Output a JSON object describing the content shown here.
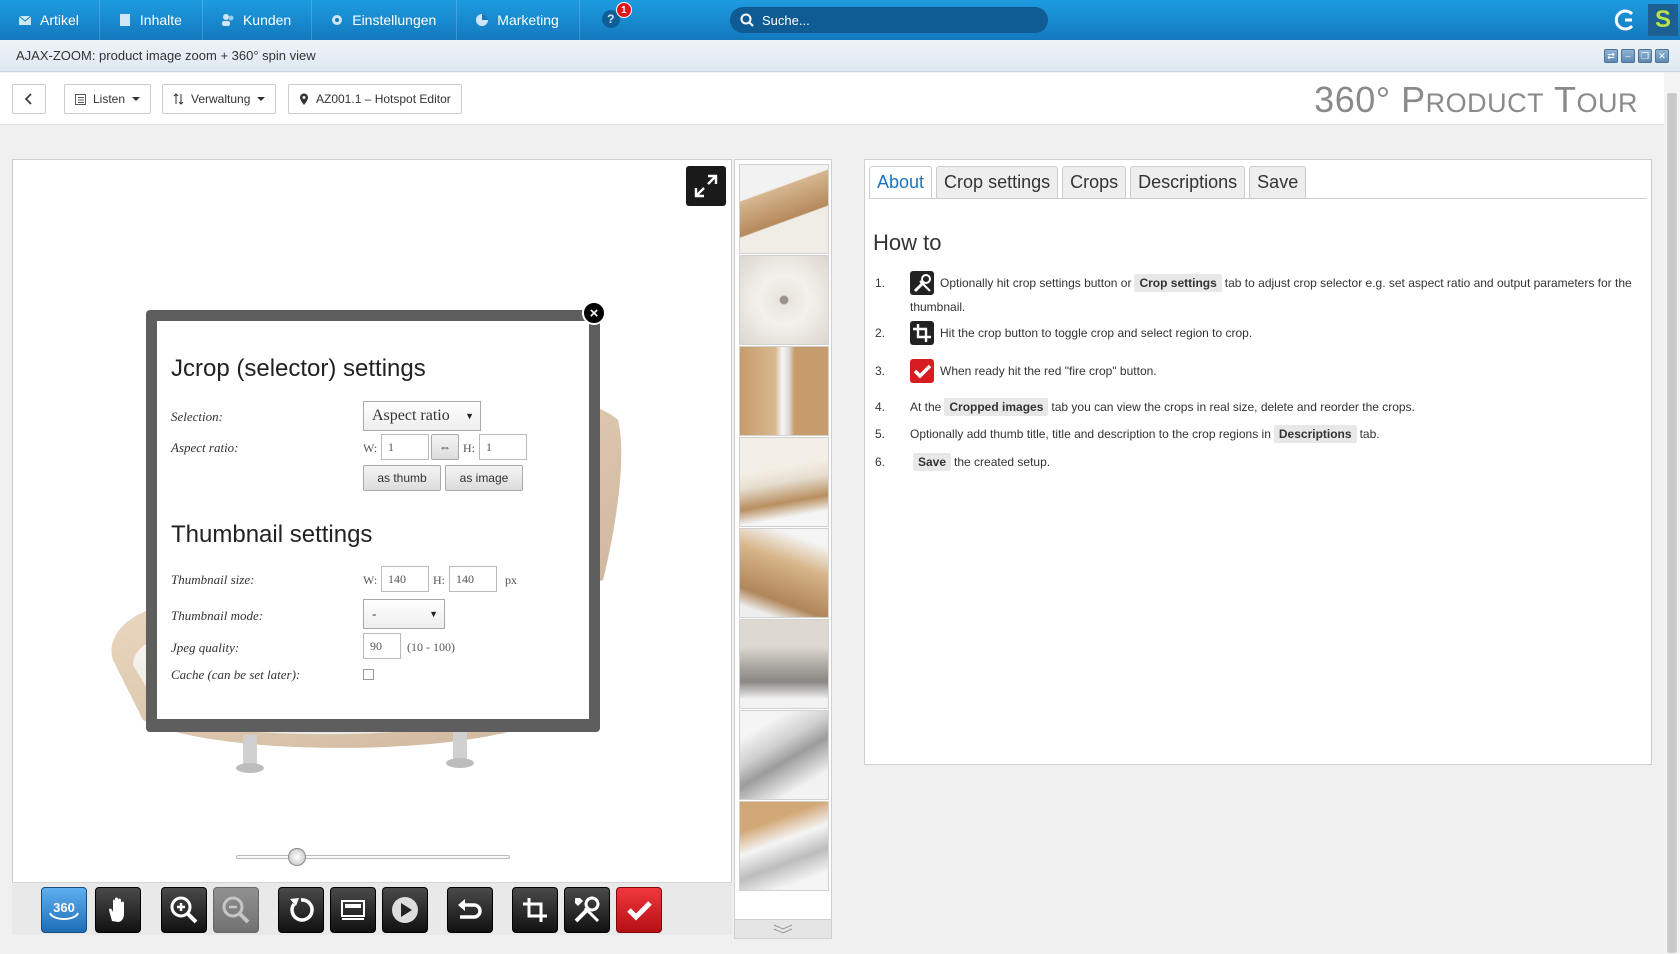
{
  "topnav": {
    "items": [
      {
        "label": "Artikel",
        "icon": "envelope-icon"
      },
      {
        "label": "Inhalte",
        "icon": "document-icon"
      },
      {
        "label": "Kunden",
        "icon": "users-icon"
      },
      {
        "label": "Einstellungen",
        "icon": "gear-icon"
      },
      {
        "label": "Marketing",
        "icon": "pie-chart-icon"
      }
    ],
    "help_badge": "1",
    "search_placeholder": "Suche..."
  },
  "window": {
    "title": "AJAX-ZOOM: product image zoom + 360° spin view"
  },
  "toolbar": {
    "listen_label": "Listen",
    "verwaltung_label": "Verwaltung",
    "editor_label": "AZ001.1 – Hotspot Editor",
    "page_title_big_1": "360° P",
    "page_title_small_1": "RODUCT",
    "page_title_big_2": " T",
    "page_title_small_2": "OUR"
  },
  "dialog": {
    "heading1": "Jcrop (selector) settings",
    "selection_label": "Selection:",
    "selection_value": "Aspect ratio",
    "aspect_label": "Aspect ratio:",
    "w_label": "W:",
    "h_label": "H:",
    "aspect_w": "1",
    "aspect_h": "1",
    "swap_symbol": "⇔",
    "as_thumb": "as thumb",
    "as_image": "as image",
    "heading2": "Thumbnail settings",
    "thumb_size_label": "Thumbnail size:",
    "thumb_w": "140",
    "thumb_h": "140",
    "px_label": "px",
    "thumb_mode_label": "Thumbnail mode:",
    "thumb_mode_value": "-",
    "jpeg_label": "Jpeg quality:",
    "jpeg_value": "90",
    "jpeg_range": "(10 - 100)",
    "cache_label": "Cache (can be set later):",
    "cache_checked": false,
    "close_symbol": "×"
  },
  "panel": {
    "tabs": [
      "About",
      "Crop settings",
      "Crops",
      "Descriptions",
      "Save"
    ],
    "active_tab": "About",
    "heading": "How to",
    "steps": [
      {
        "n": "1.",
        "a": "Optionally hit crop settings button or",
        "k": "Crop settings",
        "b": "tab to adjust crop selector e.g. set aspect ratio and output parameters for the",
        "c": "thumbnail."
      },
      {
        "n": "2.",
        "a": "Hit the crop button to toggle crop and select region to crop."
      },
      {
        "n": "3.",
        "a": "When ready hit the red \"fire crop\" button."
      },
      {
        "n": "4.",
        "a": "At the",
        "k": "Cropped images",
        "b": "tab you can view the crops in real size, delete and reorder the crops."
      },
      {
        "n": "5.",
        "a": "Optionally add thumb title, title and description to the crop regions in",
        "k": "Descriptions",
        "b": "tab."
      },
      {
        "n": "6.",
        "k": "Save",
        "b": "the created setup."
      }
    ]
  },
  "viewer": {
    "slider_position": 0.22,
    "nav_buttons": [
      "360-spin-icon",
      "pan-hand-icon",
      "zoom-in-icon",
      "zoom-out-icon",
      "reset-icon",
      "gallery-icon",
      "play-icon",
      "redo-icon",
      "crop-icon",
      "settings-tools-icon",
      "fire-crop-check-icon"
    ]
  },
  "colors": {
    "topbar": "#1787cf",
    "accent_tab": "#1a75bc",
    "fire_crop": "#e31b23"
  }
}
